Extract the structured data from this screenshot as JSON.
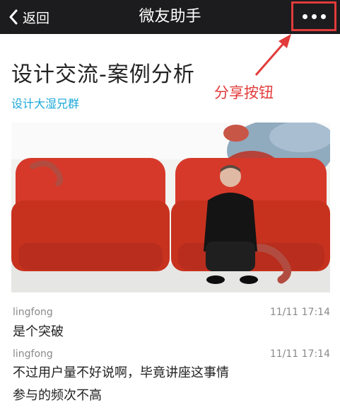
{
  "navbar": {
    "back_label": "返回",
    "title": "微友助手",
    "more_icon": "more-horizontal-icon"
  },
  "annotation": {
    "label": "分享按钮",
    "color": "#e23b3b"
  },
  "article": {
    "title": "设计交流-案例分析",
    "group": "设计大湿兄群",
    "image": "man-on-red-sofa-with-octopus-tentacles"
  },
  "comments": [
    {
      "author": "lingfong",
      "time": "11/11 17:14",
      "lines": [
        "是个突破"
      ]
    },
    {
      "author": "lingfong",
      "time": "11/11 17:14",
      "lines": [
        "不过用户量不好说啊，毕竟讲座这事情",
        "参与的频次不高"
      ]
    }
  ],
  "colors": {
    "navbar_bg": "#1c1c1e",
    "accent_link": "#1ca8d8",
    "sofa_red": "#d6392a"
  }
}
